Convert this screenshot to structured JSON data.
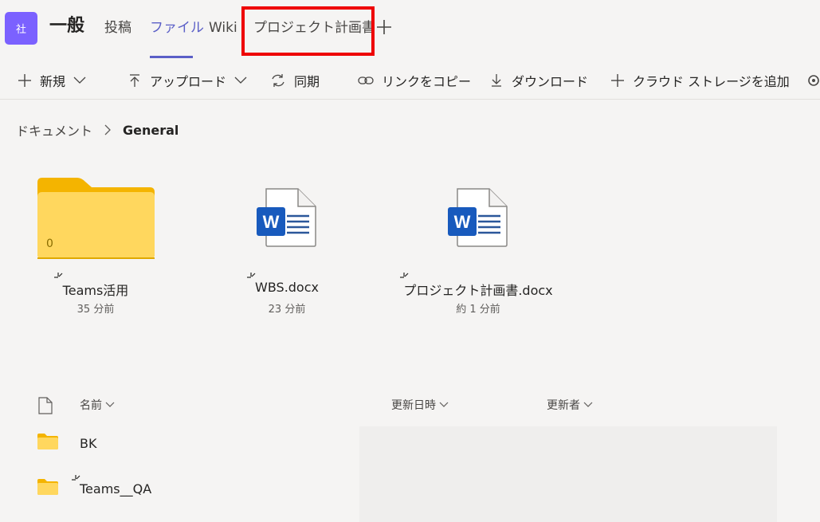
{
  "header": {
    "team_avatar": "社",
    "channel_name": "一般",
    "tabs": [
      {
        "label": "投稿"
      },
      {
        "label": "ファイル"
      },
      {
        "label": "Wiki"
      },
      {
        "label": "プロジェクト計画書"
      }
    ],
    "add_tab_icon": "plus-icon",
    "accent_color": "#5b5fc7",
    "highlight_color": "#ee0000"
  },
  "toolbar": {
    "items": [
      {
        "label": "新規",
        "icon": "plus-icon",
        "has_dropdown": true
      },
      {
        "label": "アップロード",
        "icon": "upload-icon",
        "has_dropdown": true
      },
      {
        "label": "同期",
        "icon": "sync-icon",
        "has_dropdown": false
      },
      {
        "label": "リンクをコピー",
        "icon": "link-icon",
        "has_dropdown": false
      },
      {
        "label": "ダウンロード",
        "icon": "download-icon",
        "has_dropdown": false
      },
      {
        "label": "クラウド ストレージを追加",
        "icon": "plus-icon",
        "has_dropdown": false
      }
    ]
  },
  "breadcrumb": {
    "root": "ドキュメント",
    "current": "General"
  },
  "tiles": [
    {
      "name": "Teams活用",
      "modified": "35 分前",
      "type": "folder",
      "item_count": "0"
    },
    {
      "name": "WBS.docx",
      "modified": "23 分前",
      "type": "word"
    },
    {
      "name": "プロジェクト計画書.docx",
      "modified": "約 1 分前",
      "type": "word"
    }
  ],
  "list": {
    "columns": {
      "name": "名前",
      "modified": "更新日時",
      "modified_by": "更新者"
    },
    "rows": [
      {
        "name": "BK",
        "type": "folder"
      },
      {
        "name": "Teams__QA",
        "type": "folder",
        "is_new": true
      }
    ]
  }
}
